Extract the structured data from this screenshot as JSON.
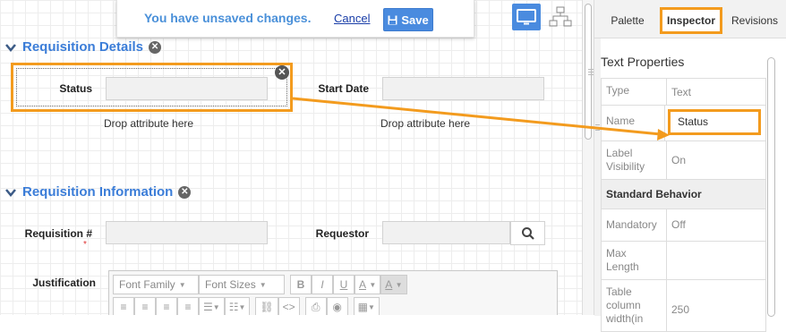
{
  "banner": {
    "message": "You have unsaved changes.",
    "cancel_label": "Cancel",
    "save_label": "Save"
  },
  "sections": {
    "details": {
      "title": "Requisition Details"
    },
    "information": {
      "title": "Requisition Information"
    }
  },
  "fields": {
    "status": "Status",
    "start_date": "Start Date",
    "drop_text": "Drop attribute here",
    "requisition_no": "Requisition #",
    "required_mark": "*",
    "requestor": "Requestor",
    "justification": "Justification"
  },
  "editor": {
    "font_family": "Font Family",
    "font_sizes": "Font Sizes",
    "bold": "B",
    "italic": "I",
    "underline": "U",
    "font_color": "A",
    "bg_color": "A",
    "code": "<>"
  },
  "panel": {
    "tabs": [
      "Palette",
      "Inspector",
      "Revisions"
    ],
    "heading": "Text Properties",
    "props": {
      "type_key": "Type",
      "type_val": "Text",
      "name_key": "Name",
      "name_val": "Status",
      "label_vis_key": "Label Visibility",
      "label_vis_val": "On",
      "group": "Standard Behavior",
      "mandatory_key": "Mandatory",
      "mandatory_val": "Off",
      "max_len_key": "Max Length",
      "max_len_val": "",
      "table_col_key": "Table column width(in",
      "table_col_val": "250"
    }
  },
  "colors": {
    "accent": "#f39b1e",
    "link": "#3b7dd8",
    "save": "#4a8bdf"
  }
}
